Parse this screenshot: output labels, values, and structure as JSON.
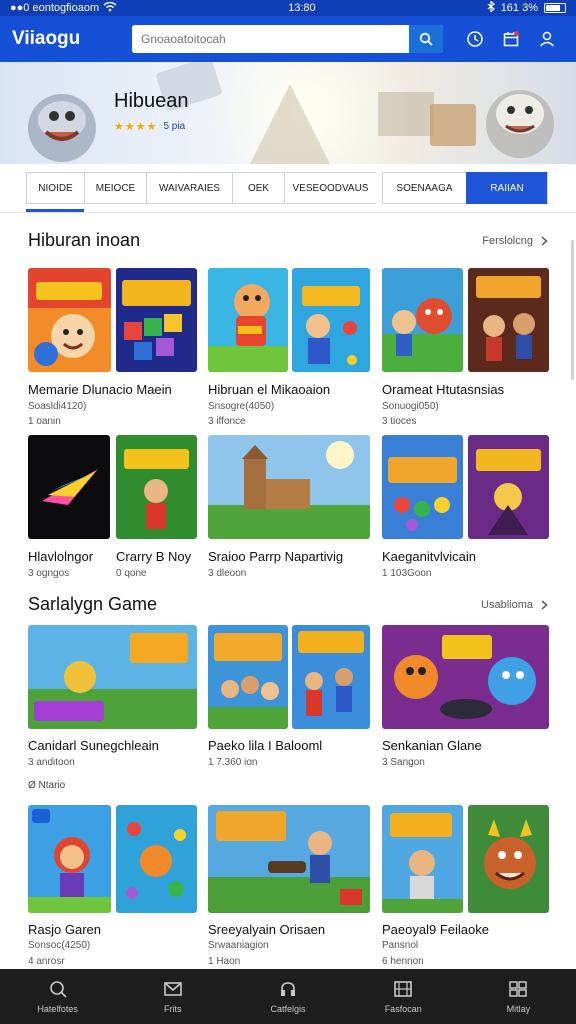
{
  "status_bar": {
    "left": "●●0 eontogfioaom",
    "time": "13:80",
    "right": "161 3%"
  },
  "app": {
    "brand": "Viiaogu"
  },
  "search": {
    "placeholder": "Gnoaoatoitocah",
    "value": ""
  },
  "hero": {
    "title": "Hibuean",
    "stars": "★★★★",
    "rating_text": "5 pia"
  },
  "tabs": [
    {
      "label": "NIOIDE",
      "active": true
    },
    {
      "label": "MEIOCE",
      "active": false
    },
    {
      "label": "WAIVARAIES",
      "active": false
    },
    {
      "label": "OEK",
      "active": false
    },
    {
      "label": "VESEOODVAUS",
      "active": false
    },
    {
      "label": "SOENAAGA",
      "active": false
    },
    {
      "label": "RAIIAN",
      "active": false,
      "primary": true
    }
  ],
  "section1": {
    "title": "Hiburan inoan",
    "see_all": "Ferslolcng"
  },
  "section2": {
    "title": "Sarlalygn Game",
    "see_all": "Usablioma"
  },
  "sub_section": {
    "label": "Ø Ntario"
  },
  "cards": [
    {
      "name": "Memarie Dlunacio Maein",
      "meta1": "Soasldi4120)",
      "meta2": "1 oanin"
    },
    {
      "name": "Hibruan el Mikaoaion",
      "meta1": "Snsogre(4050)",
      "meta2": "3 iffonce"
    },
    {
      "name": "Orameat Htutasnsias",
      "meta1": "Sonuogi050)",
      "meta2": "3 tioces"
    },
    {
      "name": "Hlavlolngor",
      "meta1": "3 ogngos",
      "meta2": ""
    },
    {
      "name": "Crarry B Noy",
      "meta1": "0 qone",
      "meta2": ""
    },
    {
      "name": "Sraioo Parrp Napartivig",
      "meta1": "3 dleoon",
      "meta2": ""
    },
    {
      "name": "Kaeganitvlvicain",
      "meta1": "1 103Goon",
      "meta2": ""
    },
    {
      "name": "Canidarl Sunegchleain",
      "meta1": "3 anditoon",
      "meta2": ""
    },
    {
      "name": "Paeko lila I Balooml",
      "meta1": "1 7.360 ion",
      "meta2": ""
    },
    {
      "name": "Senkanian Glane",
      "meta1": "3 Sangon",
      "meta2": ""
    },
    {
      "name": "Rasjo Garen",
      "meta1": "Sonsoc(4250)",
      "meta2": "4 anrosr"
    },
    {
      "name": "Sreeyalyain Orisaen",
      "meta1": "Srwaaniagion",
      "meta2": "1 Haon"
    },
    {
      "name": "Paeoyal9 Feilaoke",
      "meta1": "Pansnol",
      "meta2": "6 hennon"
    }
  ],
  "bottom_nav": [
    {
      "label": "Hatelfotes",
      "icon": "search-icon"
    },
    {
      "label": "Frits",
      "icon": "mail-icon"
    },
    {
      "label": "Catfelgis",
      "icon": "headset-icon"
    },
    {
      "label": "Fasfocan",
      "icon": "film-icon"
    },
    {
      "label": "Mitlay",
      "icon": "grid-icon"
    }
  ],
  "colors": {
    "primary": "#1550d6",
    "nav_bg": "#1e1e1e",
    "star": "#f2a900"
  }
}
